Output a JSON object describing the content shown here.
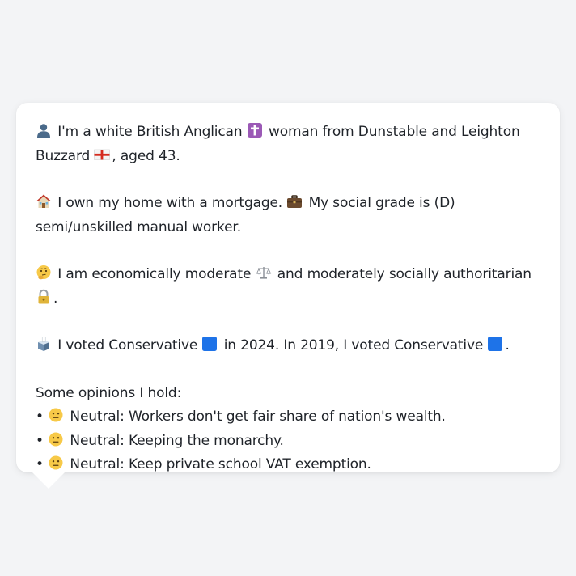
{
  "colors": {
    "background": "#f3f4f6",
    "card": "#ffffff",
    "text": "#1f2329",
    "cross_purple": "#8e44ad",
    "conservative_blue": "#1e73e8"
  },
  "profile": {
    "line1": {
      "icon": "person-silhouette-icon",
      "text_a": "I'm a white British Anglican",
      "icon2": "latin-cross-icon",
      "text_b": "woman from Dunstable and Leighton Buzzard",
      "icon3": "england-flag-icon",
      "text_c": ", aged 43."
    },
    "line2": {
      "icon": "house-icon",
      "text_a": "I own my home with a mortgage.",
      "icon2": "briefcase-icon",
      "text_b": "My social grade is (D) semi/unskilled manual worker."
    },
    "line3": {
      "icon": "thinking-face-icon",
      "text_a": "I am economically moderate",
      "icon2": "balance-scale-icon",
      "text_b": "and moderately socially authoritarian",
      "icon3": "padlock-icon",
      "text_c": "."
    },
    "line4": {
      "icon": "ballot-box-icon",
      "text_a": "I voted Conservative",
      "icon2": "blue-square-icon",
      "text_b": "in 2024. In 2019, I voted Conservative",
      "icon3": "blue-square-icon",
      "text_c": "."
    },
    "opinions_heading": "Some opinions I hold:",
    "opinions": [
      {
        "bullet": "•",
        "icon": "neutral-face-icon",
        "text": "Neutral: Workers don't get fair share of nation's wealth."
      },
      {
        "bullet": "•",
        "icon": "neutral-face-icon",
        "text": "Neutral: Keeping the monarchy."
      },
      {
        "bullet": "•",
        "icon": "neutral-face-icon",
        "text": "Neutral: Keep private school VAT exemption."
      }
    ]
  }
}
